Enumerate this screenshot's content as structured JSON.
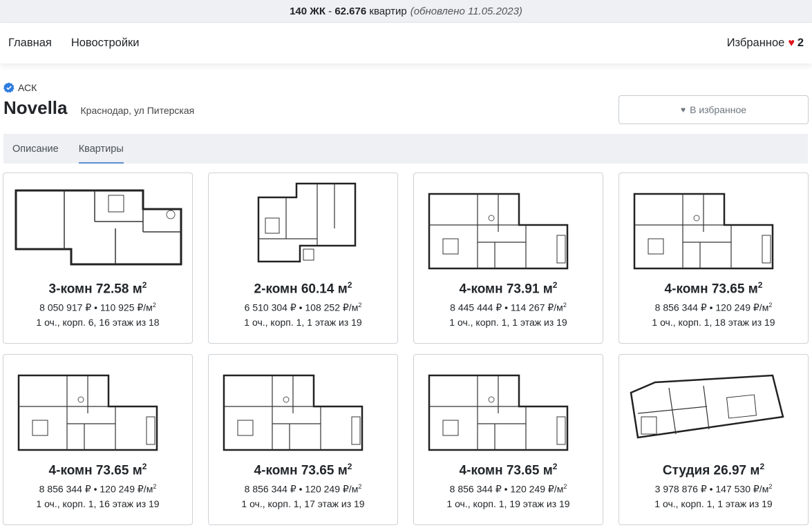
{
  "topbar": {
    "count_jk": "140",
    "jk_label": "ЖК",
    "sep": "-",
    "count_flats": "62.676",
    "flats_label": "квартир",
    "updated": "(обновлено 11.05.2023)"
  },
  "nav": {
    "home": "Главная",
    "new": "Новостройки",
    "favorites": "Избранное",
    "fav_count": "2"
  },
  "header": {
    "developer": "АСК",
    "title": "Novella",
    "address": "Краснодар, ул Питерская",
    "fav_button": "В избранное"
  },
  "tabs": [
    {
      "label": "Описание"
    },
    {
      "label": "Квартиры"
    }
  ],
  "colors": {
    "heart": "#e3141b",
    "badge": "#2f7ce0",
    "tab_underline": "#5a8fd0"
  },
  "cards": [
    {
      "title": "3-комн 72.58 м",
      "sup": "2",
      "price": "8 050 917 ₽ • 110 925 ₽/м",
      "info": "1 оч., корп. 6, 16 этаж из 18",
      "plan": "3"
    },
    {
      "title": "2-комн 60.14 м",
      "sup": "2",
      "price": "6 510 304 ₽ • 108 252 ₽/м",
      "info": "1 оч., корп. 1, 1 этаж из 19",
      "plan": "2"
    },
    {
      "title": "4-комн 73.91 м",
      "sup": "2",
      "price": "8 445 444 ₽ • 114 267 ₽/м",
      "info": "1 оч., корп. 1, 1 этаж из 19",
      "plan": "4"
    },
    {
      "title": "4-комн 73.65 м",
      "sup": "2",
      "price": "8 856 344 ₽ • 120 249 ₽/м",
      "info": "1 оч., корп. 1, 18 этаж из 19",
      "plan": "4"
    },
    {
      "title": "4-комн 73.65 м",
      "sup": "2",
      "price": "8 856 344 ₽ • 120 249 ₽/м",
      "info": "1 оч., корп. 1, 16 этаж из 19",
      "plan": "4"
    },
    {
      "title": "4-комн 73.65 м",
      "sup": "2",
      "price": "8 856 344 ₽ • 120 249 ₽/м",
      "info": "1 оч., корп. 1, 17 этаж из 19",
      "plan": "4"
    },
    {
      "title": "4-комн 73.65 м",
      "sup": "2",
      "price": "8 856 344 ₽ • 120 249 ₽/м",
      "info": "1 оч., корп. 1, 19 этаж из 19",
      "plan": "4"
    },
    {
      "title": "Студия 26.97 м",
      "sup": "2",
      "price": "3 978 876 ₽ • 147 530 ₽/м",
      "info": "1 оч., корп. 1, 1 этаж из 19",
      "plan": "S"
    }
  ]
}
